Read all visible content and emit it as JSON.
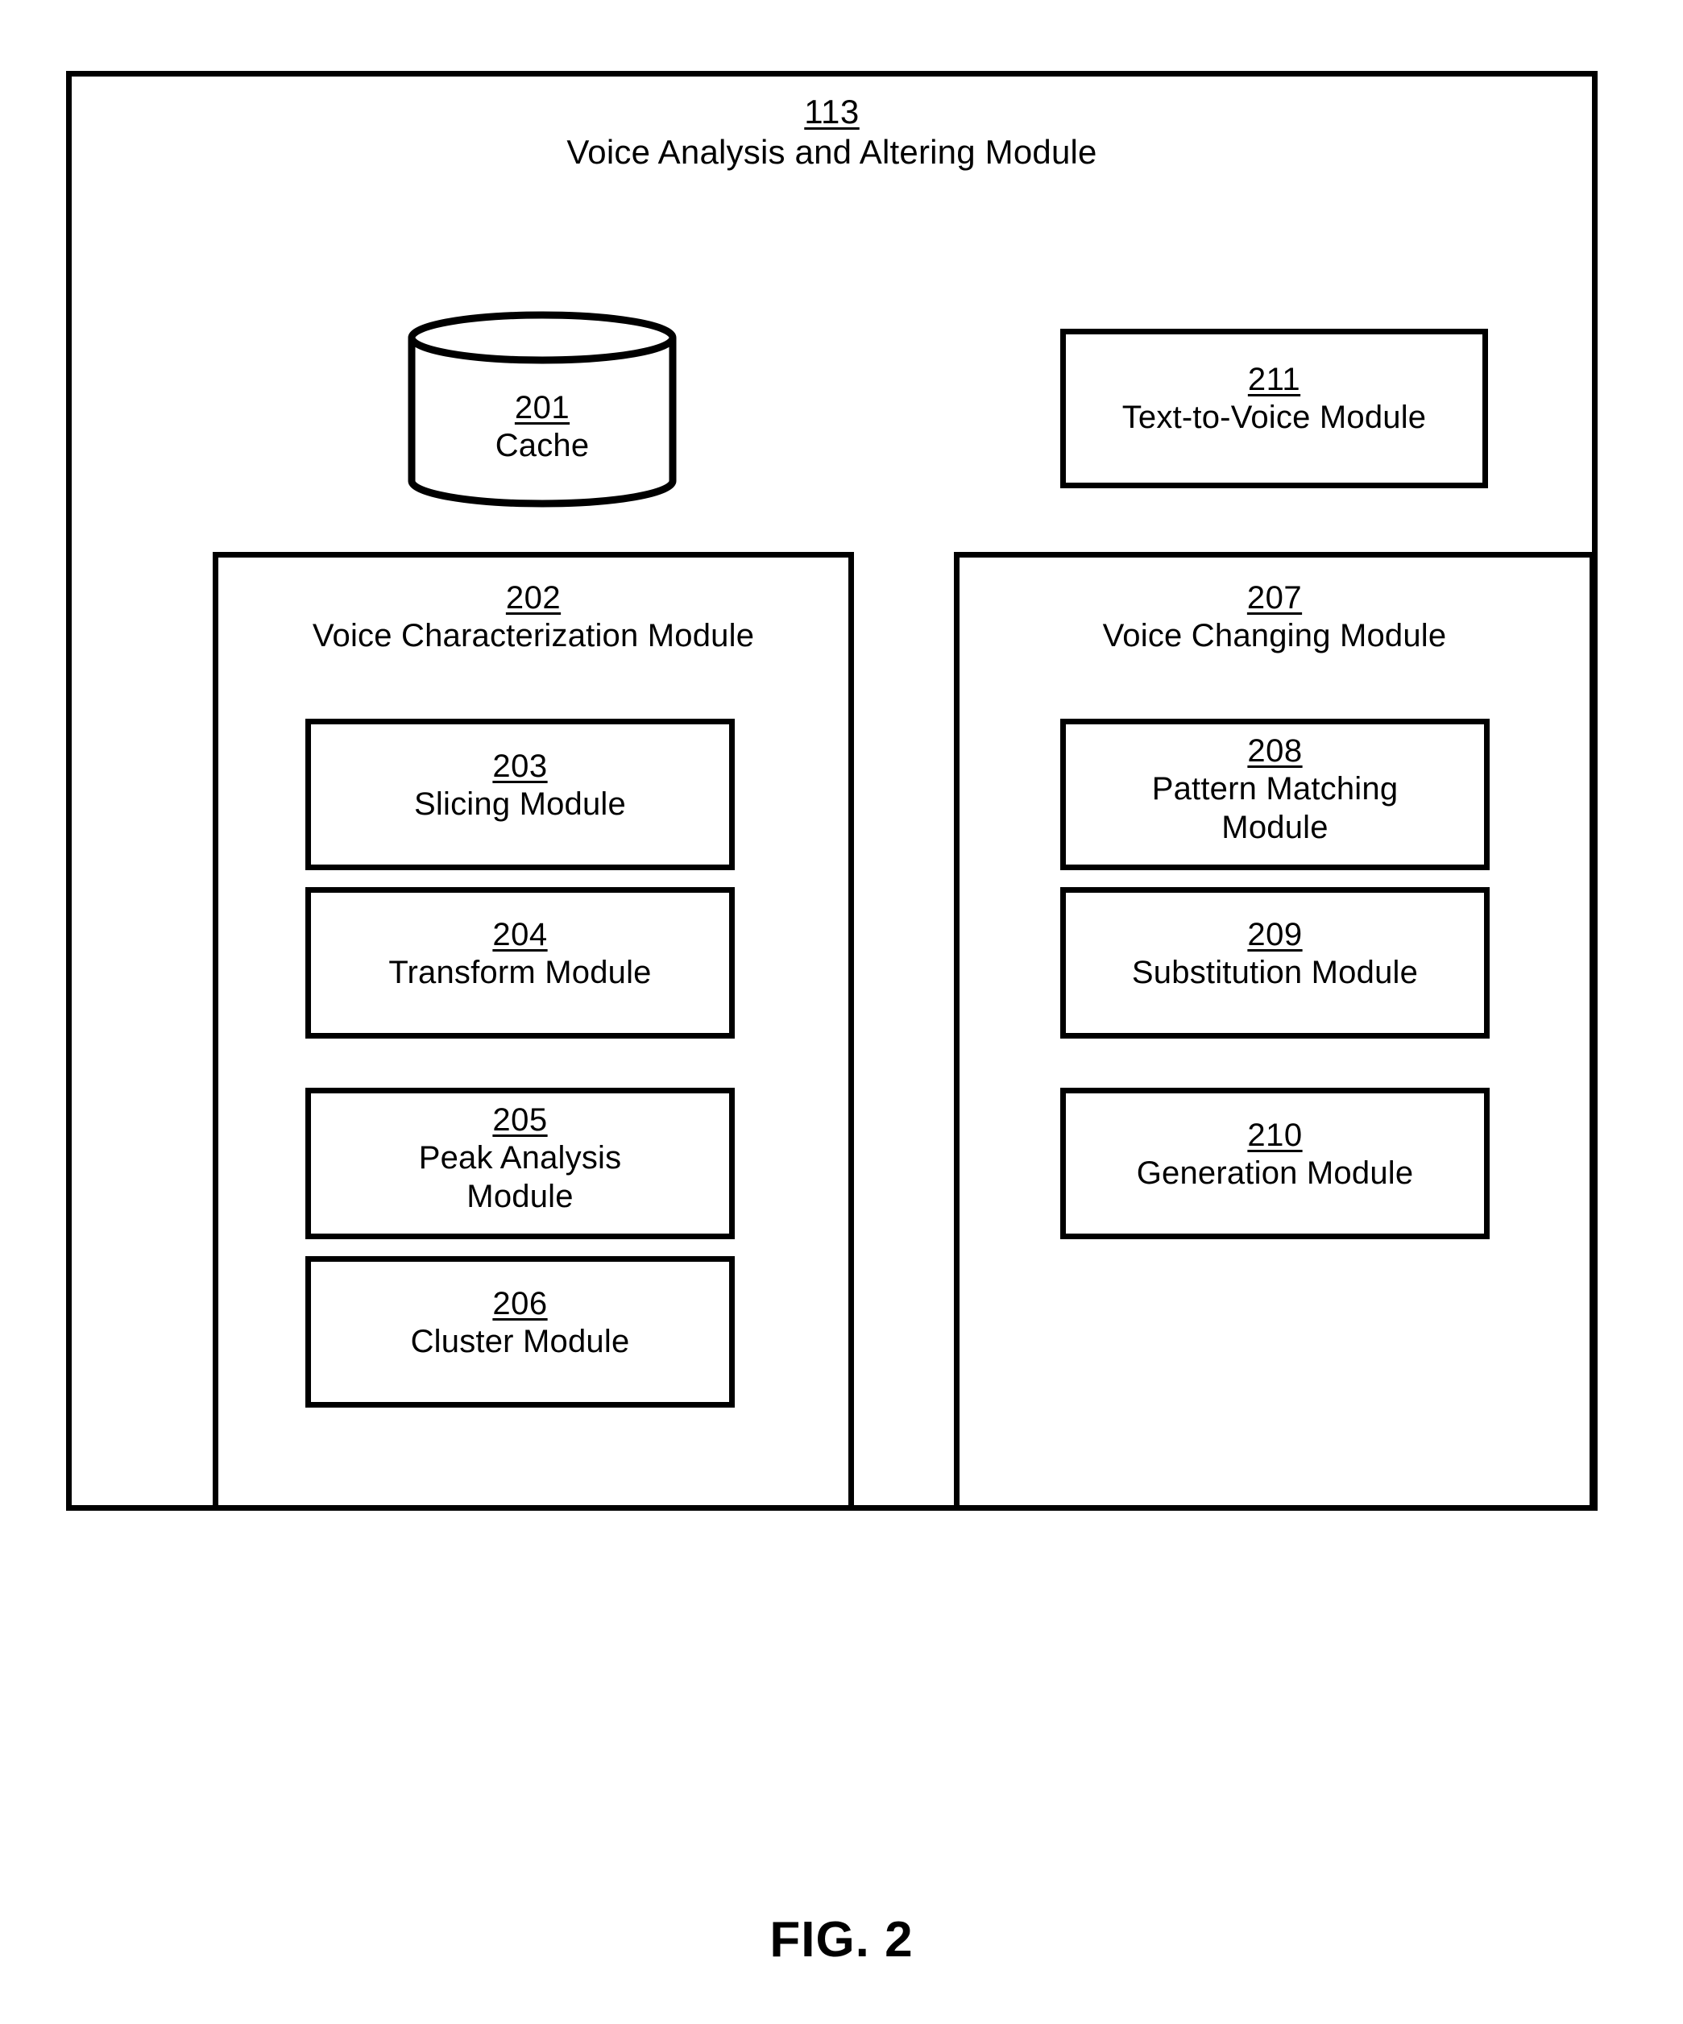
{
  "figure": {
    "caption": "FIG. 2"
  },
  "diagram": {
    "outer": {
      "ref": "113",
      "label": "Voice Analysis and Altering Module"
    },
    "cache": {
      "ref": "201",
      "label": "Cache",
      "shape": "cylinder-icon"
    },
    "text_to_voice": {
      "ref": "211",
      "label": "Text-to-Voice Module"
    },
    "columns": [
      {
        "ref": "202",
        "label": "Voice Characterization Module",
        "children": [
          {
            "ref": "203",
            "label": "Slicing Module"
          },
          {
            "ref": "204",
            "label": "Transform Module"
          },
          {
            "ref": "205",
            "label_line1": "Peak Analysis",
            "label_line2": "Module"
          },
          {
            "ref": "206",
            "label": "Cluster Module"
          }
        ]
      },
      {
        "ref": "207",
        "label": "Voice Changing Module",
        "children": [
          {
            "ref": "208",
            "label_line1": "Pattern Matching",
            "label_line2": "Module"
          },
          {
            "ref": "209",
            "label": "Substitution Module"
          },
          {
            "ref": "210",
            "label": "Generation Module"
          }
        ]
      }
    ]
  },
  "style": {
    "line_color": "#000000",
    "background": "#ffffff"
  }
}
